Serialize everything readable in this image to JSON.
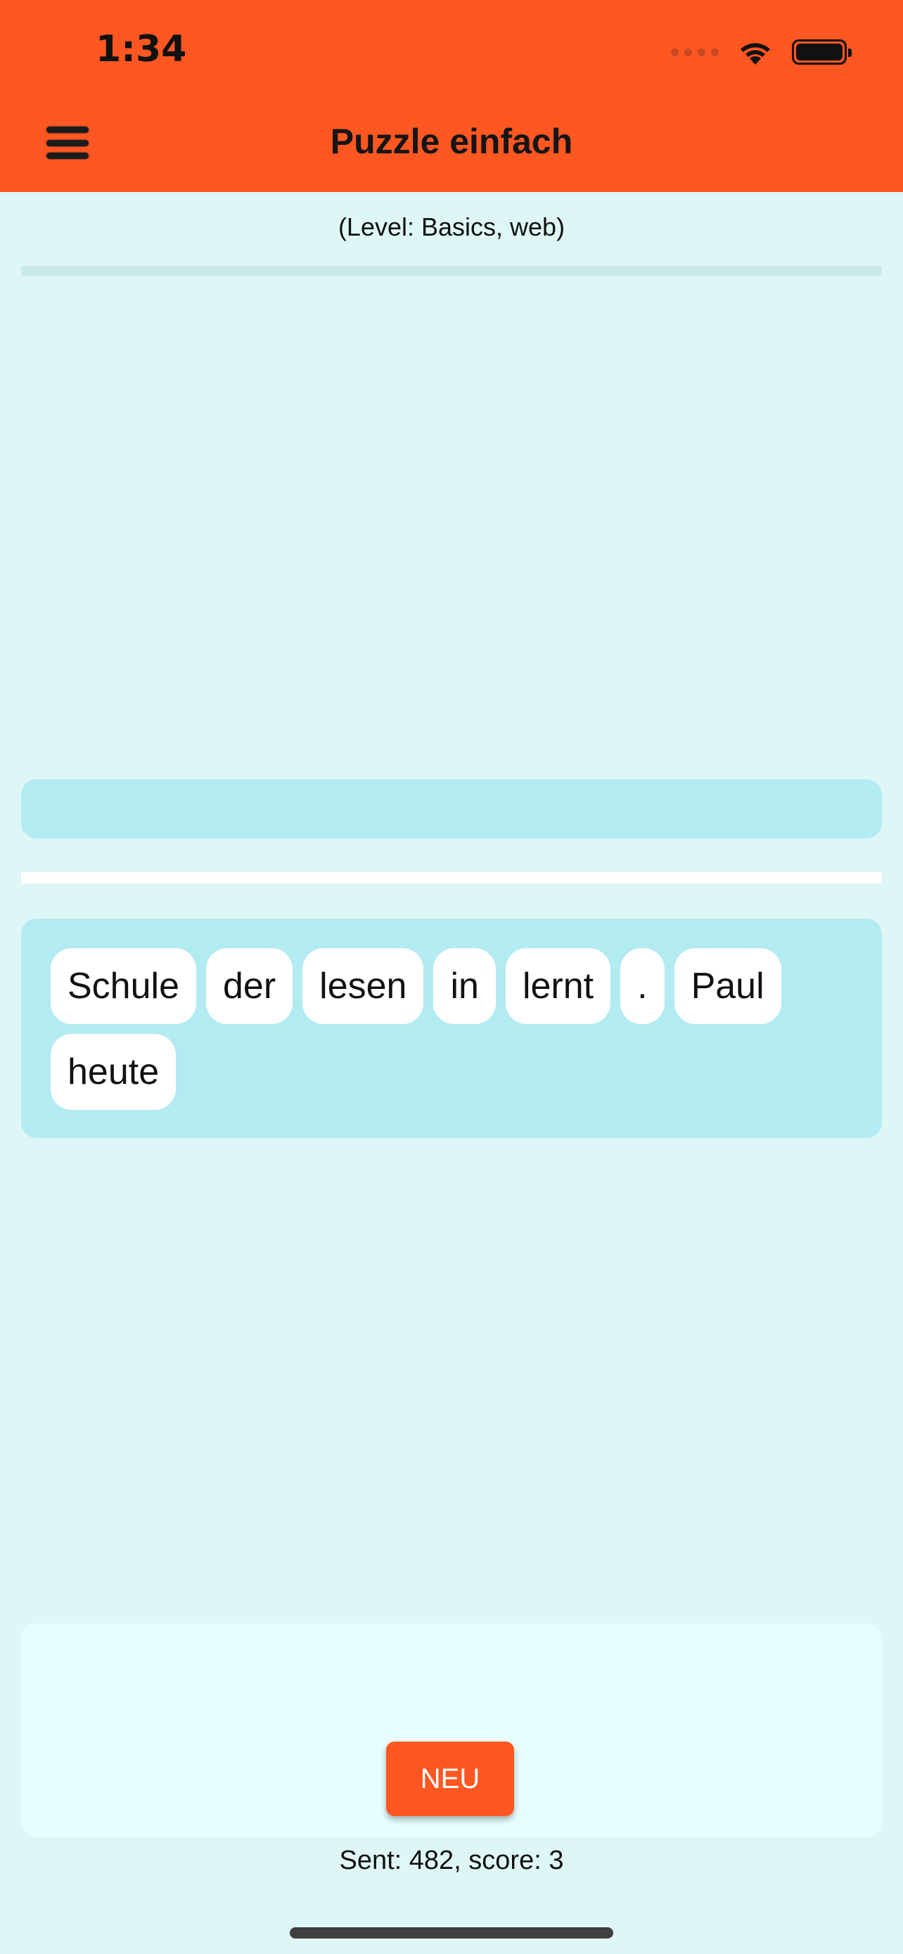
{
  "status_bar": {
    "time": "1:34"
  },
  "header": {
    "title": "Puzzle einfach"
  },
  "level": {
    "label": "(Level: Basics, web)"
  },
  "progress": {
    "fraction": 0
  },
  "word_pool": {
    "words": [
      "Schule",
      "der",
      "lesen",
      "in",
      "lernt",
      ".",
      "Paul",
      "heute"
    ]
  },
  "actions": {
    "new_label": "NEU"
  },
  "stats": {
    "text": "Sent: 482, score: 3"
  },
  "colors": {
    "accent": "#ff5722",
    "background": "#dff6f7",
    "panel": "#b3ebf2",
    "chip": "#ffffff"
  }
}
